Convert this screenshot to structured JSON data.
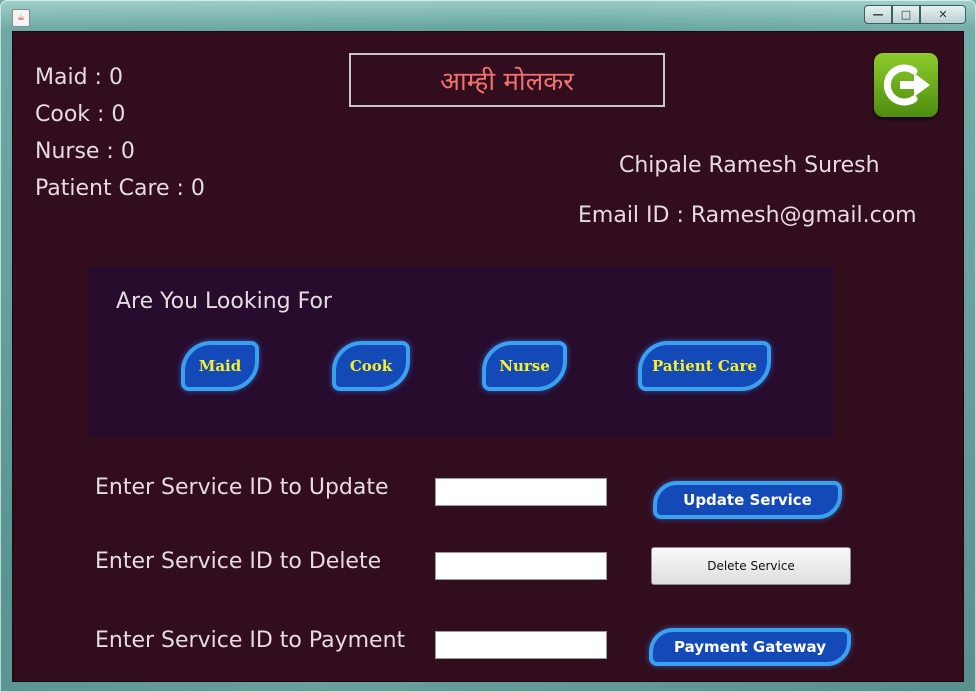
{
  "window": {
    "icon": "java-cup-icon",
    "buttons": {
      "minimize": "—",
      "maximize": "□",
      "close": "✕"
    }
  },
  "stats": [
    {
      "label": "Maid : 0"
    },
    {
      "label": "Cook : 0"
    },
    {
      "label": "Nurse : 0"
    },
    {
      "label": "Patient Care : 0"
    }
  ],
  "app_title": "आम्ही मोलकर",
  "logout_icon": "logout-arrow-icon",
  "profile": {
    "name": "Chipale Ramesh Suresh",
    "email": "Email ID : Ramesh@gmail.com"
  },
  "search_panel": {
    "heading": "Are You Looking For",
    "services": [
      "Maid",
      "Cook",
      "Nurse",
      "Patient Care"
    ]
  },
  "actions": {
    "update": {
      "label": "Enter Service ID to Update",
      "value": "",
      "button": "Update Service"
    },
    "delete": {
      "label": "Enter Service ID to Delete",
      "value": "",
      "button": "Delete Service"
    },
    "payment": {
      "label": "Enter Service ID to Payment",
      "value": "",
      "button": "Payment Gateway"
    }
  },
  "colors": {
    "background": "#320d1e",
    "panel": "#270c2e",
    "title_text": "#f07070",
    "service_button": "#1449b8",
    "service_button_border": "#3aa0f0",
    "service_text": "#f8ef2a",
    "logout": "#6aa81c"
  }
}
